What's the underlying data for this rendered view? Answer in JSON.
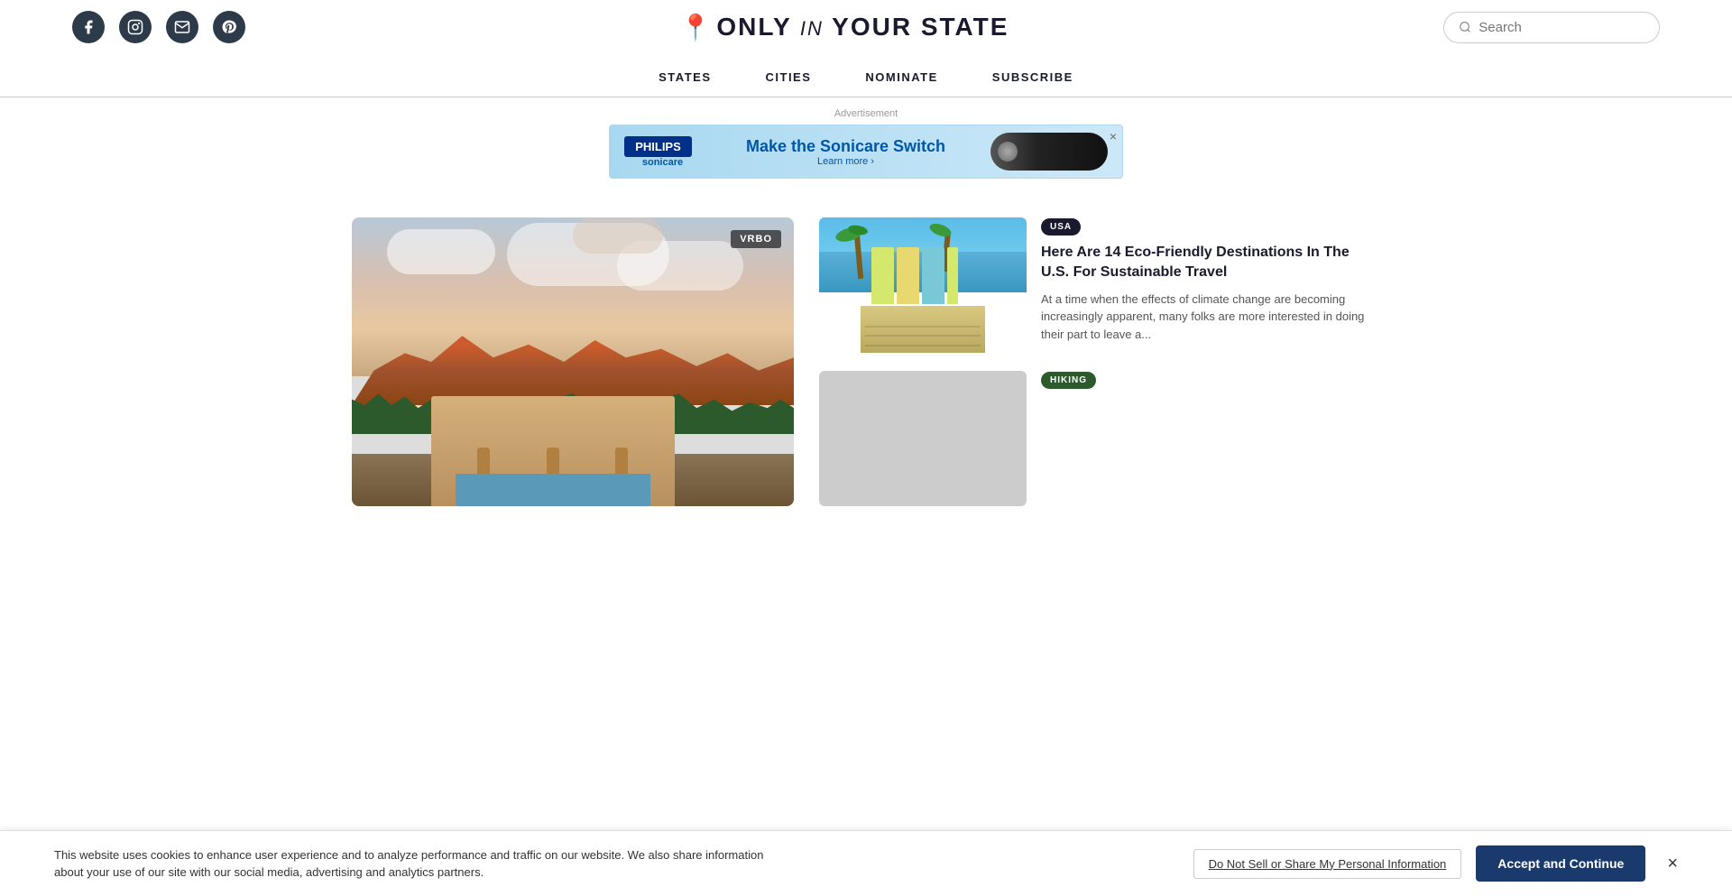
{
  "header": {
    "logo_text_only": "ONLY",
    "logo_in": "IN",
    "logo_your_state": "YOUR STATE",
    "search_placeholder": "Search"
  },
  "nav": {
    "items": [
      {
        "label": "STATES",
        "id": "states"
      },
      {
        "label": "CITIES",
        "id": "cities"
      },
      {
        "label": "NOMINATE",
        "id": "nominate"
      },
      {
        "label": "SUBSCRIBE",
        "id": "subscribe"
      }
    ]
  },
  "ad": {
    "label": "Advertisement",
    "brand": "PHILIPS",
    "sub_brand": "sonicare",
    "headline": "Make the Sonicare Switch",
    "cta": "Learn more ›"
  },
  "articles": {
    "featured": {
      "badge": "VRBO"
    },
    "card1": {
      "tag": "USA",
      "title": "Here Are 14 Eco-Friendly Destinations In The U.S. For Sustainable Travel",
      "excerpt": "At a time when the effects of climate change are becoming increasingly apparent, many folks are more interested in doing their part to leave a..."
    },
    "card2": {
      "tag": "HIKING"
    }
  },
  "cookie": {
    "text": "This website uses cookies to enhance user experience and to analyze performance and traffic on our website. We also share information about your use of our site with our social media, advertising and analytics partners.",
    "do_not_sell_label": "Do Not Sell or Share My Personal Information",
    "accept_label": "Accept and Continue",
    "close_label": "×"
  }
}
